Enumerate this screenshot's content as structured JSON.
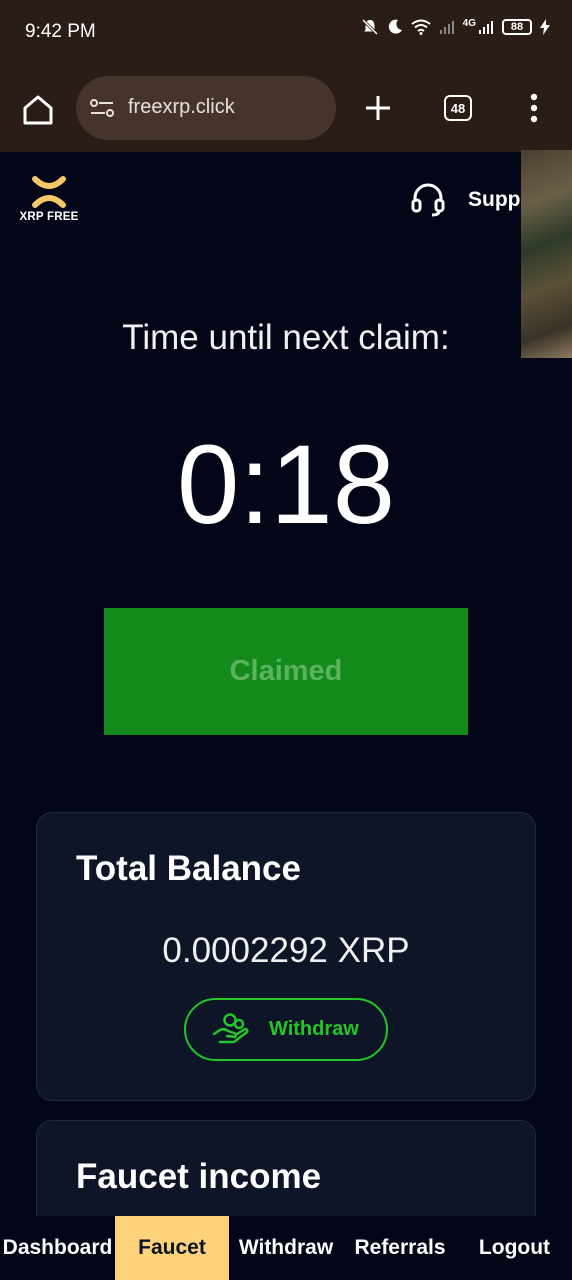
{
  "status_bar": {
    "time": "9:42 PM",
    "network": "4G",
    "battery": "88"
  },
  "browser": {
    "url": "freexrp.click",
    "tab_count": "48"
  },
  "site": {
    "logo_text": "XRP FREE",
    "support_label": "Support"
  },
  "claim": {
    "label": "Time until next claim:",
    "timer": "0:18",
    "button_label": "Claimed"
  },
  "balance_card": {
    "title": "Total Balance",
    "value": "0.0002292 XRP",
    "withdraw_label": "Withdraw"
  },
  "faucet_card": {
    "title": "Faucet income"
  },
  "bottom_nav": {
    "items": [
      {
        "label": "Dashboard"
      },
      {
        "label": "Faucet"
      },
      {
        "label": "Withdraw"
      },
      {
        "label": "Referrals"
      },
      {
        "label": "Logout"
      }
    ],
    "active": "Faucet"
  },
  "colors": {
    "page_bg": "#020617",
    "claim_button": "#158a1c",
    "accent_green": "#22c52a",
    "nav_active": "#fcd37a",
    "logo_gold": "#f5c76a"
  }
}
